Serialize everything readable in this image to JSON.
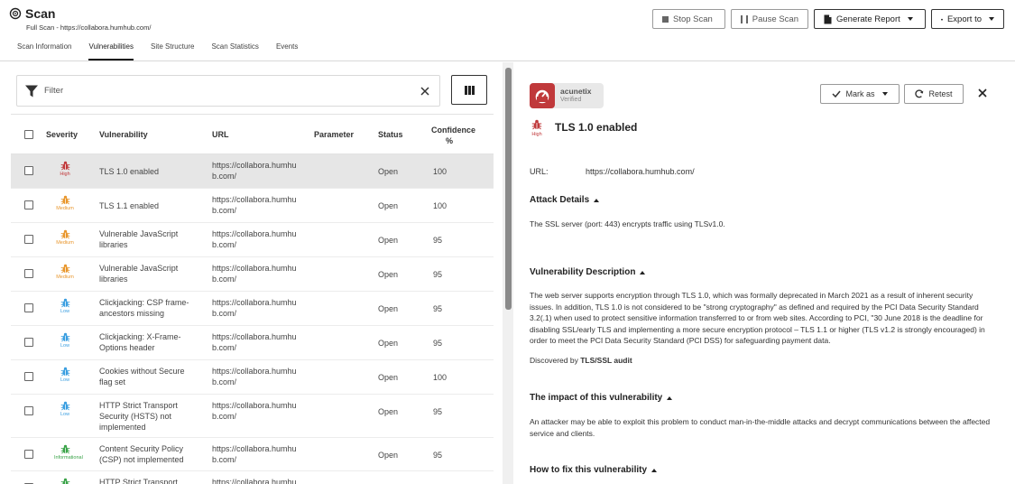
{
  "header": {
    "title": "Scan",
    "subtitle": "Full Scan - https://collabora.humhub.com/",
    "actions": {
      "stop": "Stop Scan",
      "pause": "Pause Scan",
      "generate": "Generate Report",
      "export": "Export to"
    },
    "tabs": [
      "Scan Information",
      "Vulnerabilities",
      "Site Structure",
      "Scan Statistics",
      "Events"
    ],
    "active_tab": "Vulnerabilities"
  },
  "filter": {
    "label": "Filter"
  },
  "table": {
    "columns": {
      "severity": "Severity",
      "vulnerability": "Vulnerability",
      "url": "URL",
      "parameter": "Parameter",
      "status": "Status",
      "confidence": "Confidence %"
    },
    "rows": [
      {
        "severity": "High",
        "name": "TLS 1.0 enabled",
        "url": "https://collabora.humhu b.com/",
        "status": "Open",
        "confidence": "100"
      },
      {
        "severity": "Medium",
        "name": "TLS 1.1 enabled",
        "url": "https://collabora.humhu b.com/",
        "status": "Open",
        "confidence": "100"
      },
      {
        "severity": "Medium",
        "name": "Vulnerable JavaScript libraries",
        "url": "https://collabora.humhu b.com/",
        "status": "Open",
        "confidence": "95"
      },
      {
        "severity": "Medium",
        "name": "Vulnerable JavaScript libraries",
        "url": "https://collabora.humhu b.com/",
        "status": "Open",
        "confidence": "95"
      },
      {
        "severity": "Low",
        "name": "Clickjacking: CSP frame-ancestors missing",
        "url": "https://collabora.humhu b.com/",
        "status": "Open",
        "confidence": "95"
      },
      {
        "severity": "Low",
        "name": "Clickjacking: X-Frame-Options header",
        "url": "https://collabora.humhu b.com/",
        "status": "Open",
        "confidence": "95"
      },
      {
        "severity": "Low",
        "name": "Cookies without Secure flag set",
        "url": "https://collabora.humhu b.com/",
        "status": "Open",
        "confidence": "100"
      },
      {
        "severity": "Low",
        "name": "HTTP Strict Transport Security (HSTS) not implemented",
        "url": "https://collabora.humhu b.com/",
        "status": "Open",
        "confidence": "95"
      },
      {
        "severity": "Informational",
        "name": "Content Security Policy (CSP) not implemented",
        "url": "https://collabora.humhu b.com/",
        "status": "Open",
        "confidence": "95"
      },
      {
        "severity": "Informational",
        "name": "HTTP Strict Transport",
        "url": "https://collabora.humhu",
        "status": "",
        "confidence": ""
      }
    ]
  },
  "colors": {
    "High": "#c0393b",
    "Medium": "#e8962c",
    "Low": "#3a9ee0",
    "Informational": "#3aa348"
  },
  "detail": {
    "badge": {
      "brand": "acunetix",
      "label": "Verified"
    },
    "mark_as": "Mark as",
    "retest": "Retest",
    "severity": "High",
    "title": "TLS 1.0 enabled",
    "url_label": "URL:",
    "url_value": "https://collabora.humhub.com/",
    "attack_details": {
      "heading": "Attack Details",
      "text": "The SSL server (port: 443) encrypts traffic using TLSv1.0."
    },
    "description": {
      "heading": "Vulnerability Description",
      "text": "The web server supports encryption through TLS 1.0, which was formally deprecated in March 2021 as a result of inherent security issues. In addition, TLS 1.0 is not considered to be \"strong cryptography\" as defined and required by the PCI Data Security Standard 3.2(.1) when used to protect sensitive information transferred to or from web sites. According to PCI, \"30 June 2018 is the deadline for disabling SSL/early TLS and implementing a more secure encryption protocol – TLS 1.1 or higher (TLS v1.2 is strongly encouraged) in order to meet the PCI Data Security Standard (PCI DSS) for safeguarding payment data.",
      "discovered_prefix": "Discovered by",
      "discovered_by": "TLS/SSL audit"
    },
    "impact": {
      "heading": "The impact of this vulnerability",
      "text": "An attacker may be able to exploit this problem to conduct man-in-the-middle attacks and decrypt communications between the affected service and clients."
    },
    "fix": {
      "heading": "How to fix this vulnerability"
    }
  }
}
